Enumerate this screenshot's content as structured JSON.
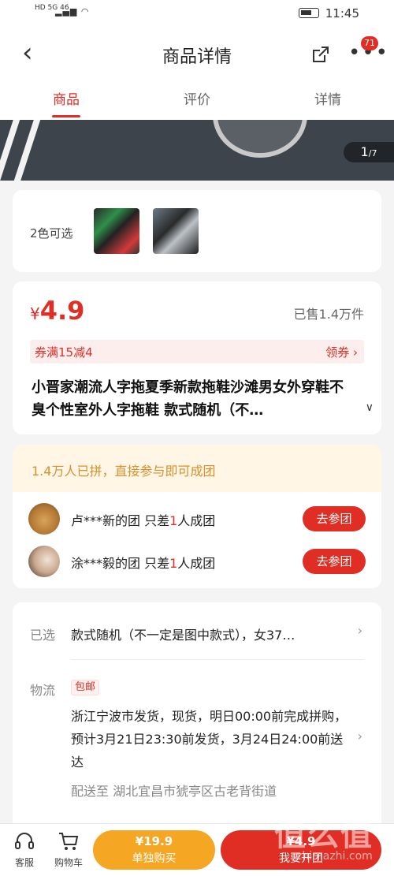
{
  "status_bar": {
    "carrier_left": "HD 5G 46",
    "time": "11:45"
  },
  "header": {
    "title": "商品详情",
    "back_icon": "chevron-left-icon",
    "share_icon": "share-icon",
    "more_icon": "more-icon",
    "badge_count": "71"
  },
  "tabs": [
    {
      "label": "商品",
      "active": true
    },
    {
      "label": "评价",
      "active": false
    },
    {
      "label": "详情",
      "active": false
    }
  ],
  "gallery": {
    "current": "1",
    "total": "/7"
  },
  "colors": {
    "label": "2色可选"
  },
  "price": {
    "currency": "¥",
    "amount": "4.9",
    "sold": "已售1.4万件"
  },
  "coupon": {
    "text": "券满15减4",
    "link": "领券 ›"
  },
  "product": {
    "title": "小晋家潮流人字拖夏季新款拖鞋沙滩男女外穿鞋不臭个性室外人字拖鞋 款式随机（不…"
  },
  "group": {
    "headline": "1.4万人已拼，直接参与即可成团",
    "rows": [
      {
        "prefix": "卢***新的团 只差",
        "count": "1",
        "suffix": "人成团",
        "button": "去参团"
      },
      {
        "prefix": "涂***毅的团 只差",
        "count": "1",
        "suffix": "人成团",
        "button": "去参团"
      }
    ]
  },
  "options": {
    "selected_label": "已选",
    "selected_value": "款式随机（不一定是图中款式），女37…",
    "logistics_label": "物流",
    "free_shipping": "包邮",
    "shipping_text": "浙江宁波市发货，现货，明日00:00前完成拼购，预计3月21日23:30前发货，3月24日24:00前送达",
    "deliver_to": "配送至 湖北宜昌市猇亭区古老背街道"
  },
  "bottom_bar": {
    "service_label": "客服",
    "cart_label": "购物车",
    "single_price": "¥19.9",
    "single_label": "单独购买",
    "group_price": "¥4.9",
    "group_label": "我要开团"
  },
  "watermark": {
    "main": "值么值",
    "sub": "zhimazhi.com"
  },
  "accent_color": "#e02e24"
}
